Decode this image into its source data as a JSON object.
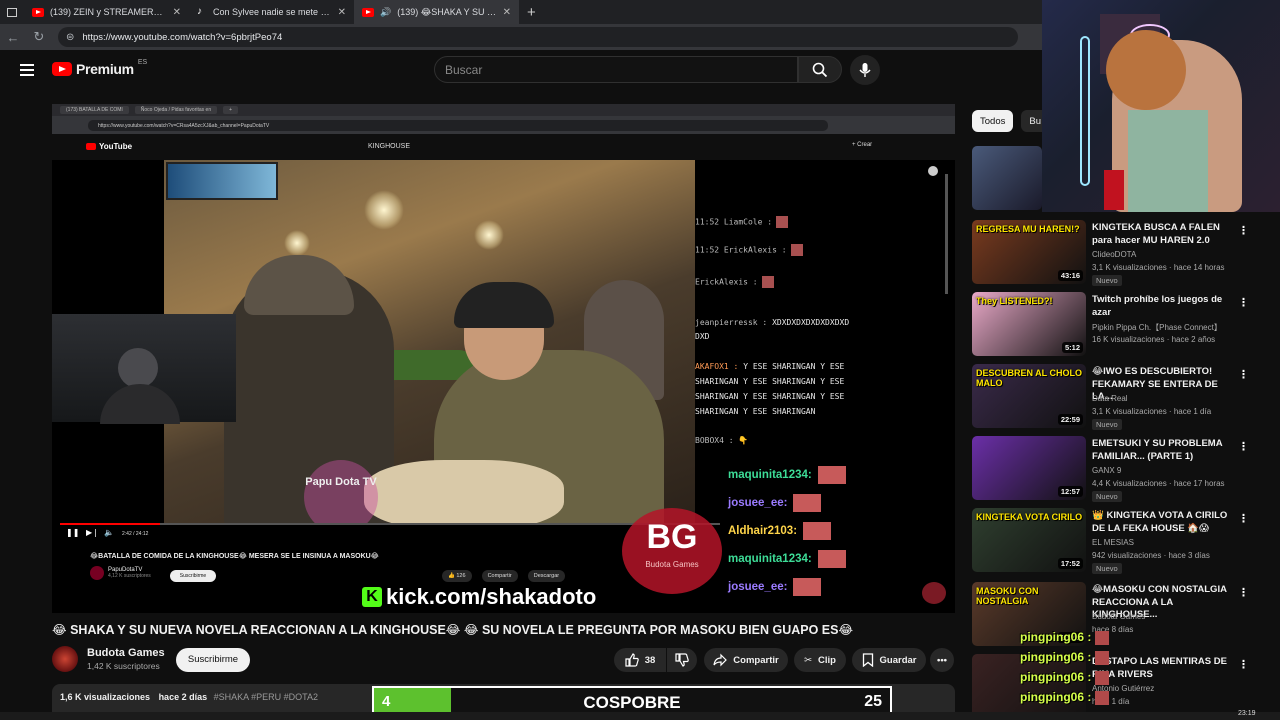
{
  "browser": {
    "tabs": [
      {
        "title": "(139) ZEIN y STREAMERS le MAN",
        "icon": "youtube-icon"
      },
      {
        "title": "Con Sylvee nadie se mete 😎👌",
        "icon": "tiktok-icon"
      },
      {
        "title": "(139) 😂SHAKA Y SU NUEVA",
        "icon": "youtube-icon"
      }
    ],
    "url": "https://www.youtube.com/watch?v=6pbrjtPeo74"
  },
  "header": {
    "brand": "Premium",
    "region": "ES",
    "search_placeholder": "Buscar"
  },
  "player": {
    "inner_tabs": [
      "(173) BATALLA DE COMI",
      "Ñoco Ojeda / Pidas favoritas en",
      "+"
    ],
    "inner_url": "https://www.youtube.com/watch?v=CRsa4A5zcXJ&ab_channel=PapuDotaTV",
    "inner_brand": "YouTube",
    "inner_search": "KINGHOUSE",
    "inner_crear": "+ Crear",
    "time": "2:42 / 24:12",
    "watermark": "Papu Dota TV",
    "inner_title": "😂BATALLA DE COMIDA DE LA KINGHOUSE😂 MESERA SE LE INSINUA A MASOKU😂",
    "inner_channel": "PapuDotaTV",
    "inner_subs": "4,12 K suscriptores",
    "inner_subscribe": "Suscribirme",
    "inner_actions": [
      "👍 126",
      "Compartir",
      "Descargar"
    ],
    "chat_small": [
      {
        "user": "11:52 LiamCole :",
        "msg": ""
      },
      {
        "user": "11:52 ErickAlexis :",
        "msg": ""
      },
      {
        "user": "ErickAlexis :",
        "msg": ""
      },
      {
        "user": "jeanpierressk :",
        "msg": "XDXDXDXDXDXDXDXD"
      },
      {
        "user": "",
        "msg": "DXD"
      },
      {
        "user": "AKAFOX1 :",
        "msg": "Y ESE SHARINGAN Y ESE"
      },
      {
        "user": "",
        "msg": "SHARINGAN Y ESE SHARINGAN Y ESE"
      },
      {
        "user": "",
        "msg": "SHARINGAN Y ESE SHARINGAN Y ESE"
      },
      {
        "user": "",
        "msg": "SHARINGAN Y ESE SHARINGAN"
      },
      {
        "user": "BOBOX4 :",
        "msg": "👇"
      }
    ],
    "chat_big": [
      {
        "user": "maquinita1234:",
        "color": "#3ddc97"
      },
      {
        "user": "josuee_ee:",
        "color": "#9b7bff"
      },
      {
        "user": "Aldhair2103:",
        "color": "#ffd54a"
      },
      {
        "user": "maquinita1234:",
        "color": "#3ddc97"
      },
      {
        "user": "josuee_ee:",
        "color": "#9b7bff"
      }
    ],
    "kick_text": "kick.com/shakadoto",
    "bg_logo": "BG",
    "bg_logo_sub": "Budota Games"
  },
  "video": {
    "title": "😂 SHAKA Y SU NUEVA NOVELA REACCIONAN A LA KINGHOUSE😂 😂 SU NOVELA LE PREGUNTA POR MASOKU BIEN GUAPO ES😂",
    "channel": "Budota Games",
    "subscribers": "1,42 K suscriptores",
    "subscribe_label": "Suscribirme",
    "likes": "38",
    "share": "Compartir",
    "clip": "Clip",
    "save": "Guardar",
    "views": "1,6 K visualizaciones",
    "date": "hace 2 días",
    "tags": "#SHAKA #PERU #DOTA2"
  },
  "overlay_bar": {
    "level": "4",
    "name": "COSPOBRE",
    "count": "25",
    "progress": 0.15,
    "color": "#5dc12e"
  },
  "chips": [
    "Todos",
    "Bu"
  ],
  "recommendations": [
    {
      "title": "KINGTEKA BUSCA A FALEN para hacer MU HAREN 2.0",
      "channel": "ClideoDOTA",
      "meta": "3,1 K visualizaciones · hace 14 horas",
      "badge": "Nuevo",
      "duration": "43:16",
      "overlay": "REGRESA MU HAREN!?",
      "thumb": "#7a3b1f"
    },
    {
      "title": "Twitch prohíbe los juegos de azar",
      "channel": "Pipkin Pippa Ch.【Phase Connect】",
      "meta": "16 K visualizaciones · hace 2 años",
      "badge": "",
      "duration": "5:12",
      "overlay": "They LISTENED?!",
      "thumb": "#e9a9c8"
    },
    {
      "title": "😂IWO ES DESCUBIERTO! FEKAMARY SE ENTERA DE LA...",
      "channel": "Data Real",
      "meta": "3,1 K visualizaciones · hace 1 día",
      "badge": "Nuevo",
      "duration": "22:59",
      "overlay": "DESCUBREN AL CHOLO MALO",
      "thumb": "#3a2a4a"
    },
    {
      "title": "EMETSUKI Y SU PROBLEMA FAMILIAR... (PARTE 1)",
      "channel": "GANX 9",
      "meta": "4,4 K visualizaciones · hace 17 horas",
      "badge": "Nuevo",
      "duration": "12:57",
      "overlay": "",
      "thumb": "#6b2fa8"
    },
    {
      "title": "👑 KINGTEKA VOTA A CIRILO DE LA FEKA HOUSE 🏠😱",
      "channel": "EL MESIAS",
      "meta": "942 visualizaciones · hace 3 días",
      "badge": "Nuevo",
      "duration": "17:52",
      "overlay": "KINGTEKA VOTA CIRILO",
      "thumb": "#2f3f2f"
    },
    {
      "title": "😂MASOKU CON NOSTALGIA REACCIONA A LA KINGHOUSE...",
      "channel": "Budota Games",
      "meta": "hace 8 días",
      "badge": "",
      "duration": "15:17",
      "overlay": "MASOKU CON NOSTALGIA",
      "thumb": "#5a3a2a"
    },
    {
      "title": "DESTAPO LAS MENTIRAS DE RINA RIVERS",
      "channel": "Antonio Gutiérrez",
      "meta": "hace 1 día",
      "badge": "",
      "duration": "",
      "overlay": "",
      "thumb": "#3a2222"
    }
  ],
  "pingpong": [
    "pingping06 :",
    "pingping06 :",
    "pingping06 :",
    "pingping06 :"
  ],
  "taskbar_time": "23:19"
}
